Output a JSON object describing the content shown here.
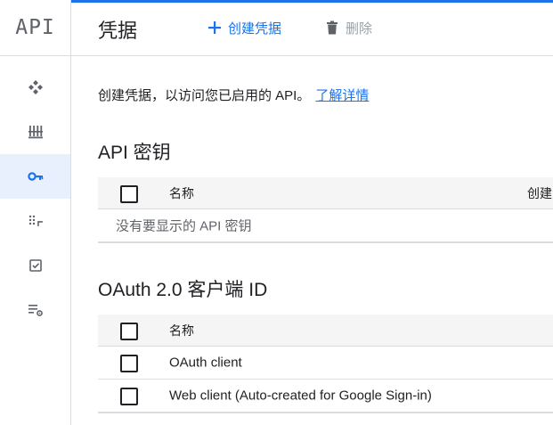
{
  "sidebar": {
    "logo": "API",
    "items": [
      {
        "icon": "apis-services-icon"
      },
      {
        "icon": "library-icon"
      },
      {
        "icon": "credentials-key-icon",
        "active": true
      },
      {
        "icon": "oauth-consent-icon"
      },
      {
        "icon": "domain-verification-icon"
      },
      {
        "icon": "page-usage-settings-icon"
      }
    ]
  },
  "header": {
    "title": "凭据",
    "create_label": "创建凭据",
    "delete_label": "删除"
  },
  "intro": {
    "text": "创建凭据，以访问您已启用的 API。",
    "link": "了解详情"
  },
  "api_keys": {
    "title": "API 密钥",
    "col_name": "名称",
    "col_created": "创建",
    "empty_message": "没有要显示的 API 密钥"
  },
  "oauth": {
    "title": "OAuth 2.0 客户端 ID",
    "col_name": "名称",
    "rows": [
      {
        "name": "OAuth client"
      },
      {
        "name": "Web client (Auto-created for Google Sign-in)"
      }
    ]
  },
  "colors": {
    "accent": "#1a73e8",
    "active_nav_bg": "#e8f0fe",
    "disabled": "#9aa0a6"
  }
}
